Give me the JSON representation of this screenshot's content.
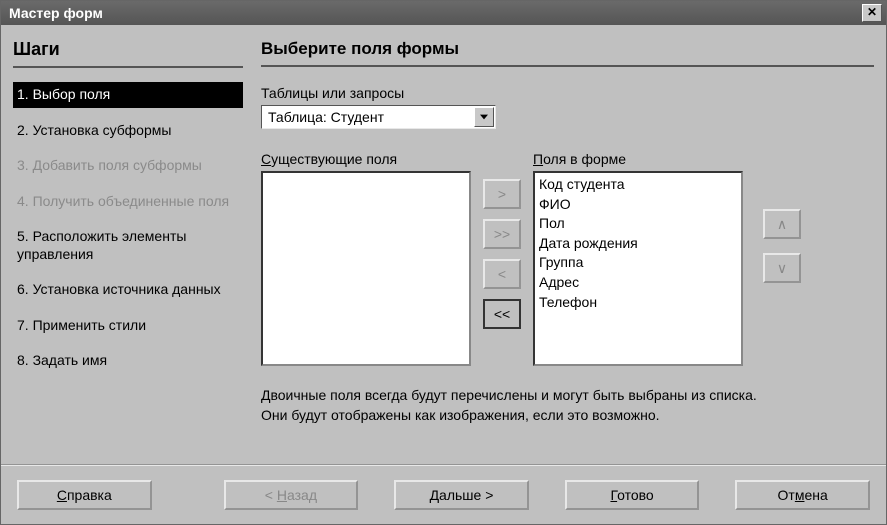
{
  "window": {
    "title": "Мастер форм"
  },
  "sidebar": {
    "header": "Шаги",
    "steps": [
      {
        "label": "1. Выбор поля",
        "state": "active"
      },
      {
        "label": "2. Установка субформы",
        "state": "normal"
      },
      {
        "label": "3. Добавить поля субформы",
        "state": "disabled"
      },
      {
        "label": "4. Получить объединенные поля",
        "state": "disabled"
      },
      {
        "label": "5. Расположить элементы управления",
        "state": "normal"
      },
      {
        "label": "6. Установка источника данных",
        "state": "normal"
      },
      {
        "label": "7. Применить стили",
        "state": "normal"
      },
      {
        "label": "8. Задать имя",
        "state": "normal"
      }
    ]
  },
  "main": {
    "header": "Выберите поля формы",
    "tables_label": "Таблицы или запросы",
    "table_selected": "Таблица: Студент",
    "existing_label_ul": "С",
    "existing_label_rest": "уществующие поля",
    "existing_fields": [],
    "form_fields_label_ul": "П",
    "form_fields_label_rest": "оля в форме",
    "form_fields": [
      "Код студента",
      "ФИО",
      "Пол",
      "Дата рождения",
      "Группа",
      "Адрес",
      "Телефон"
    ],
    "transfer": {
      "add": ">",
      "add_all": ">>",
      "remove": "<",
      "remove_all": "<<"
    },
    "reorder": {
      "up": "∧",
      "down": "∨"
    },
    "hint_line1": "Двоичные поля всегда будут перечислены и могут быть выбраны из списка.",
    "hint_line2": "Они будут отображены как изображения, если это возможно."
  },
  "footer": {
    "help_ul": "С",
    "help_rest": "правка",
    "back_pre": "< ",
    "back_ul": "Н",
    "back_rest": "азад",
    "next_ul": "Д",
    "next_rest": "альше >",
    "finish_ul": "Г",
    "finish_rest": "отово",
    "cancel_pre": "От",
    "cancel_ul": "м",
    "cancel_rest": "ена"
  }
}
